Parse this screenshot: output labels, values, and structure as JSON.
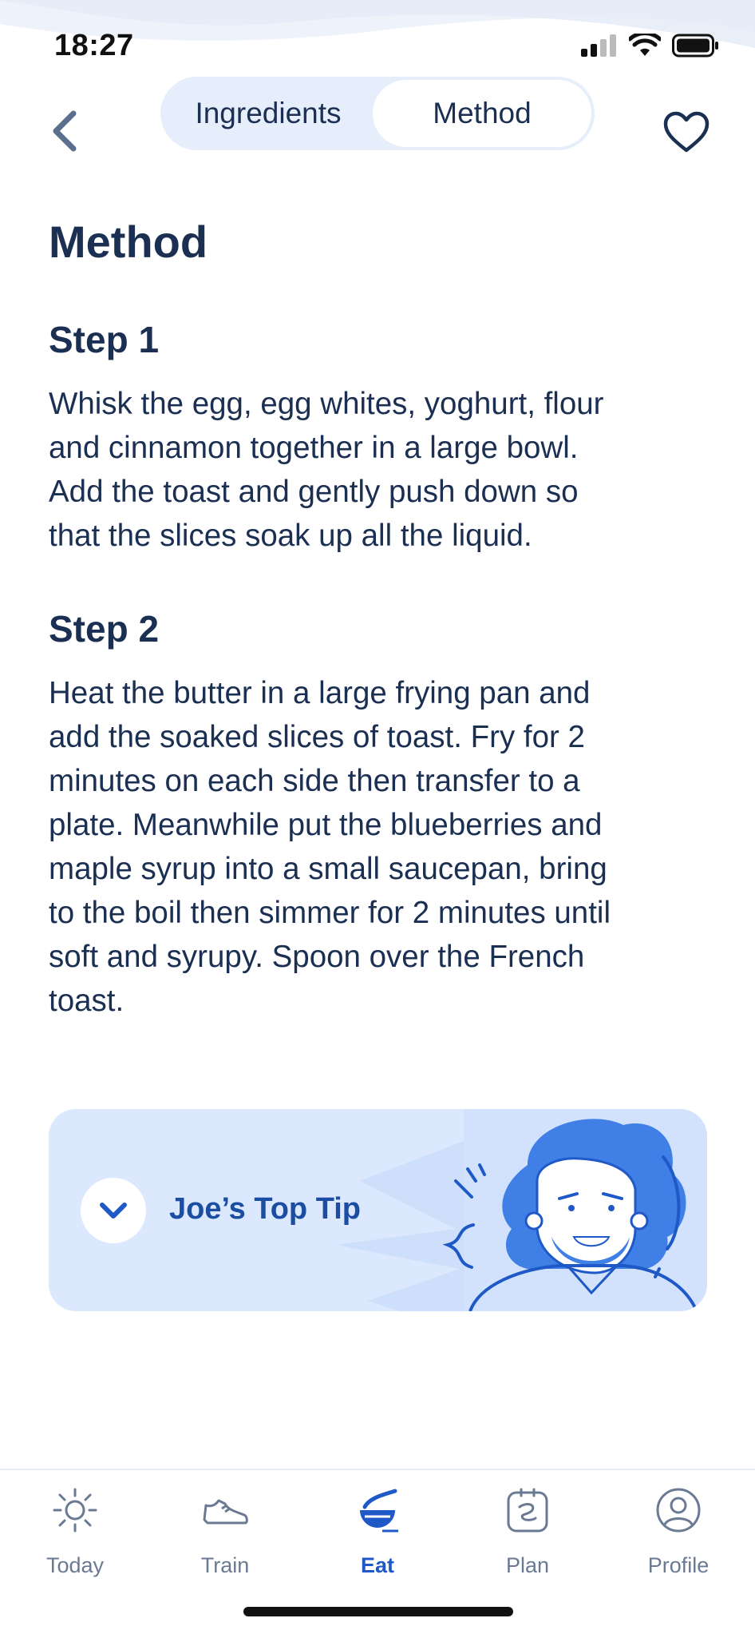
{
  "status_bar": {
    "time": "18:27"
  },
  "header": {
    "tabs": [
      {
        "label": "Ingredients",
        "active": false
      },
      {
        "label": "Method",
        "active": true
      }
    ]
  },
  "content": {
    "title": "Method",
    "steps": [
      {
        "heading": "Step 1",
        "lines": [
          "Whisk the egg, egg whites, yoghurt, flour",
          "and cinnamon together in a large bowl.",
          "Add the toast and gently push down so",
          "that the slices soak up all the liquid."
        ]
      },
      {
        "heading": "Step 2",
        "lines": [
          "Heat the butter in a large frying pan and",
          "add the soaked slices of toast. Fry for 2",
          "minutes on each side then transfer to a",
          "plate. Meanwhile put the blueberries and",
          "maple syrup into a small saucepan, bring",
          "to the boil then simmer for 2 minutes until",
          "soft and syrupy. Spoon over the French",
          "toast."
        ]
      }
    ],
    "tip": {
      "label": "Joe’s Top Tip"
    }
  },
  "tabbar": {
    "items": [
      {
        "label": "Today",
        "icon": "sun-icon"
      },
      {
        "label": "Train",
        "icon": "shoe-icon"
      },
      {
        "label": "Eat",
        "icon": "bowl-icon",
        "active": true
      },
      {
        "label": "Plan",
        "icon": "planner-icon"
      },
      {
        "label": "Profile",
        "icon": "profile-icon"
      }
    ]
  },
  "colors": {
    "primary_text": "#1b2f52",
    "accent": "#1f59c7",
    "segment_bg": "#e6eefb",
    "tip_bg": "#dbe8fd"
  }
}
